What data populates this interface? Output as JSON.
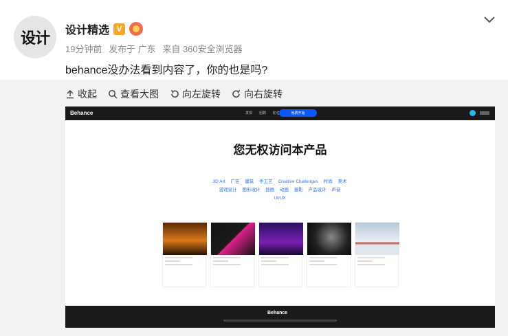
{
  "post": {
    "avatar_text": "设计",
    "author": "设计精选",
    "verified_badge": "V",
    "meta_time": "19分钟前",
    "meta_location": "发布于 广东",
    "meta_source": "来自 360安全浏览器",
    "text": "behance没办法看到内容了，你的也是吗?"
  },
  "toolbar": {
    "collapse": "收起",
    "view_large": "查看大图",
    "rotate_left": "向左旋转",
    "rotate_right": "向右旋转"
  },
  "screenshot": {
    "logo": "Behance",
    "nav_links": [
      "发现",
      "招聘",
      "职位"
    ],
    "pill": "免费开始",
    "title": "您无权访问本产品",
    "tags": [
      "3D Art",
      "广告",
      "建筑",
      "手工艺",
      "Creative Challenges",
      "时尚",
      "美术",
      "游戏设计",
      "图形设计",
      "插画",
      "动画",
      "摄影",
      "产品设计",
      "声音",
      "UI/UX"
    ],
    "footer_logo": "Behance"
  },
  "colors": {
    "accent_blue": "#2a6fff",
    "panel_gray": "#f2f2f2",
    "behance_dark": "#191919"
  }
}
